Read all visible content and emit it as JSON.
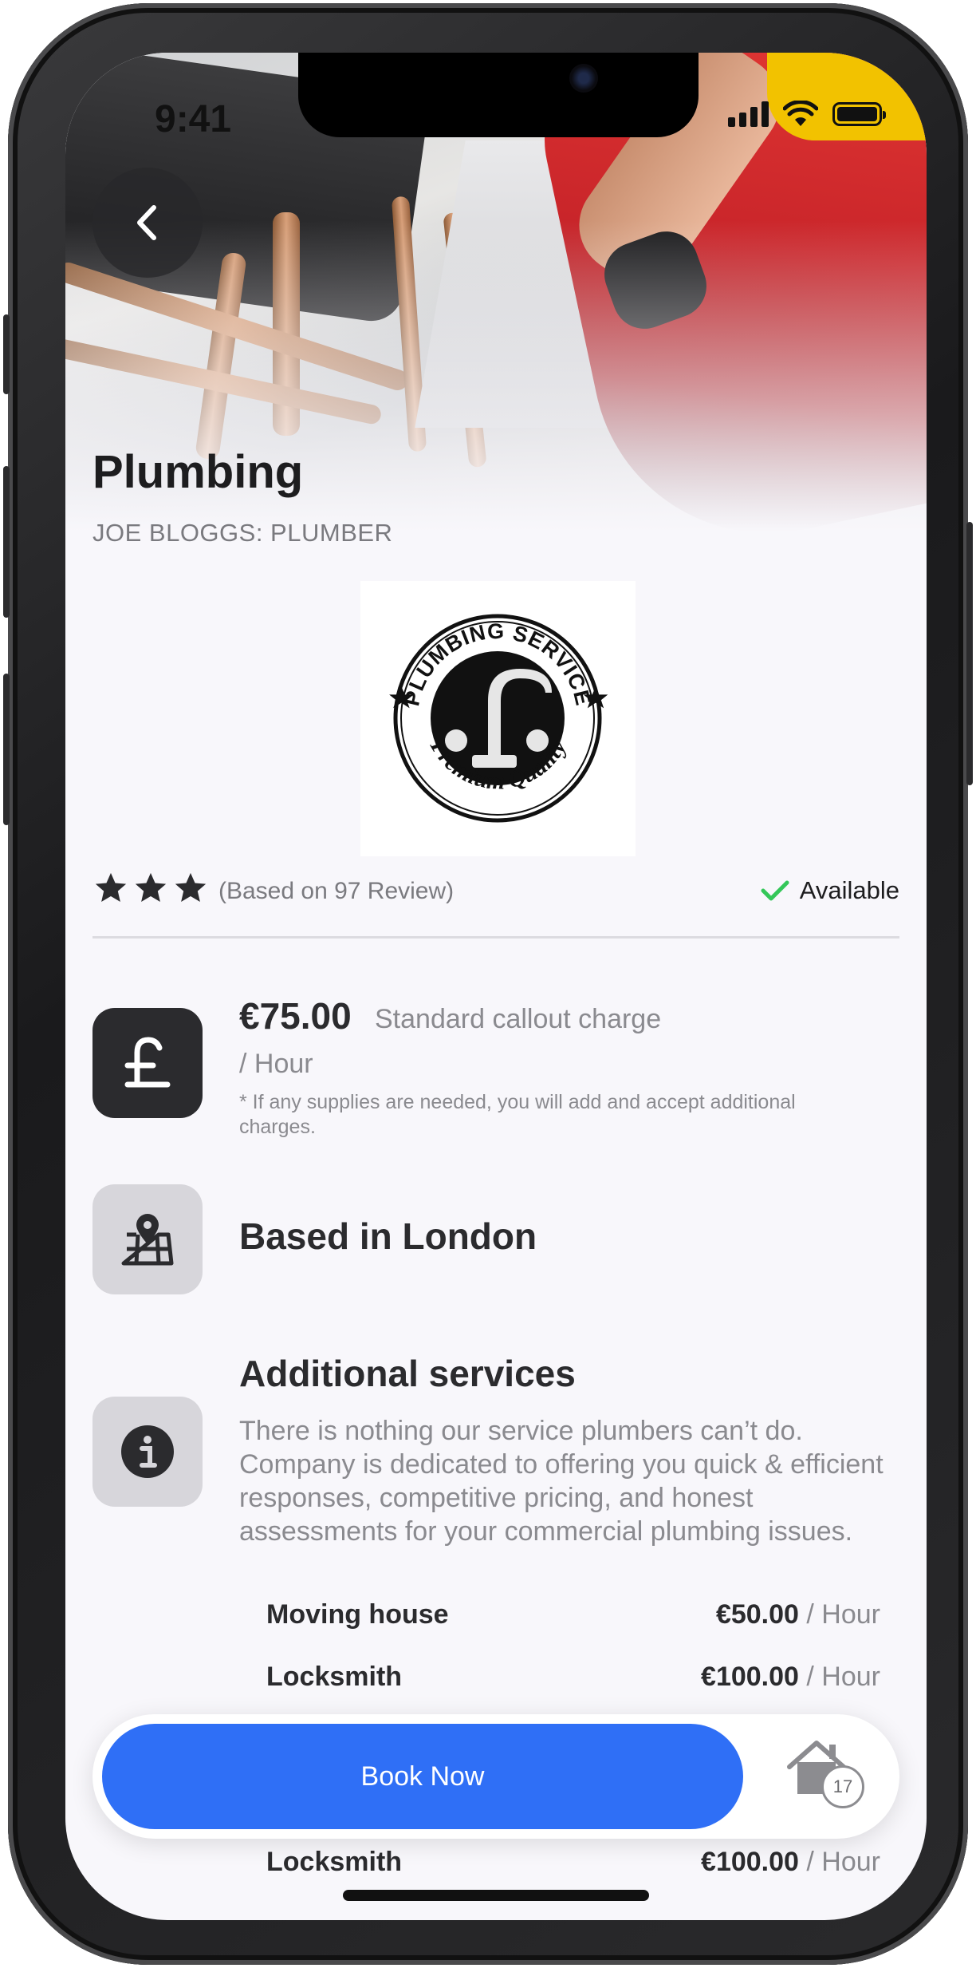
{
  "status_bar": {
    "time": "9:41"
  },
  "header": {
    "title": "Plumbing",
    "subtitle": "JOE BLOGGS: PLUMBER"
  },
  "logo": {
    "top_text": "PLUMBING SERVICE",
    "bottom_text": "Premium Quality"
  },
  "rating": {
    "stars": 3,
    "review_text": "(Based on 97 Review)",
    "availability": "Available",
    "availability_color": "#34c759"
  },
  "pricing": {
    "price": "€75.00",
    "description": "Standard callout charge",
    "unit": "/ Hour",
    "note": "* If any supplies are needed, you will add and accept additional charges."
  },
  "location": {
    "text": "Based in London"
  },
  "additional": {
    "title": "Additional services",
    "description": "There is nothing our service plumbers can’t do. Company is dedicated to offering you quick & efficient responses, competitive pricing, and honest assessments for your commercial plumbing issues.",
    "services": [
      {
        "name": "Moving house",
        "price": "€50.00",
        "unit": "/ Hour"
      },
      {
        "name": "Locksmith",
        "price": "€100.00",
        "unit": "/ Hour"
      },
      {
        "name": "Locksmith",
        "price": "€100.00",
        "unit": "/ Hour"
      }
    ]
  },
  "booking": {
    "button_label": "Book Now",
    "home_count": "17",
    "accent_color": "#2f6ff6"
  },
  "icons": [
    "back-chevron-icon",
    "pound-icon",
    "map-pin-icon",
    "info-icon",
    "star-icon",
    "checkmark-icon",
    "home-icon",
    "signal-icon",
    "wifi-icon",
    "battery-icon"
  ]
}
